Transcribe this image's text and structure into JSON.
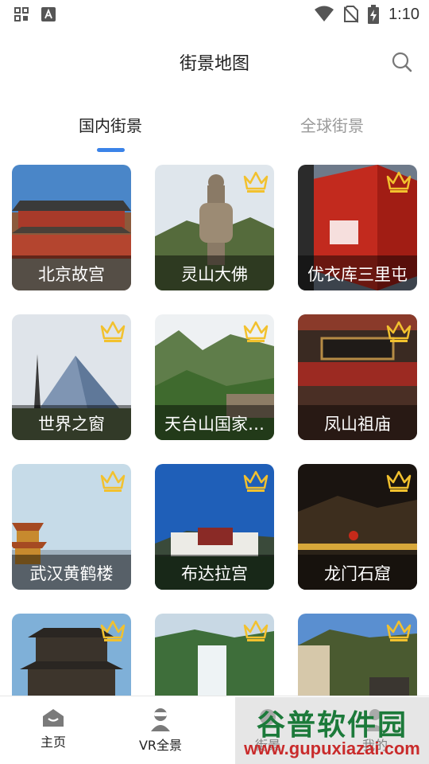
{
  "status_bar": {
    "time": "1:10",
    "icons": [
      "grid-app-icon",
      "text-app-icon",
      "wifi-icon",
      "no-sim-icon",
      "battery-charging-icon"
    ]
  },
  "header": {
    "title": "街景地图",
    "search_icon": "search-icon"
  },
  "tabs": [
    {
      "label": "国内街景",
      "active": true
    },
    {
      "label": "全球街景",
      "active": false
    }
  ],
  "colors": {
    "accent": "#3b83e8",
    "crown": "#f2c12e",
    "inactive_tab": "#9a9a9a"
  },
  "cards": [
    {
      "label": "北京故宫",
      "vip": false
    },
    {
      "label": "灵山大佛",
      "vip": true
    },
    {
      "label": "优衣库三里屯",
      "vip": true
    },
    {
      "label": "世界之窗",
      "vip": true
    },
    {
      "label": "天台山国家…",
      "vip": true
    },
    {
      "label": "凤山祖庙",
      "vip": true
    },
    {
      "label": "武汉黄鹤楼",
      "vip": true
    },
    {
      "label": "布达拉宫",
      "vip": true
    },
    {
      "label": "龙门石窟",
      "vip": true
    },
    {
      "label": "",
      "vip": true
    },
    {
      "label": "",
      "vip": true
    },
    {
      "label": "",
      "vip": true
    }
  ],
  "bottom_nav": [
    {
      "label": "主页",
      "icon": "home-icon"
    },
    {
      "label": "VR全景",
      "icon": "vr-person-icon"
    },
    {
      "label": "街景",
      "icon": "street-view-icon"
    },
    {
      "label": "我的",
      "icon": "profile-icon"
    }
  ],
  "watermark": {
    "title": "谷普软件园",
    "url": "www.gupuxiazai.com"
  }
}
